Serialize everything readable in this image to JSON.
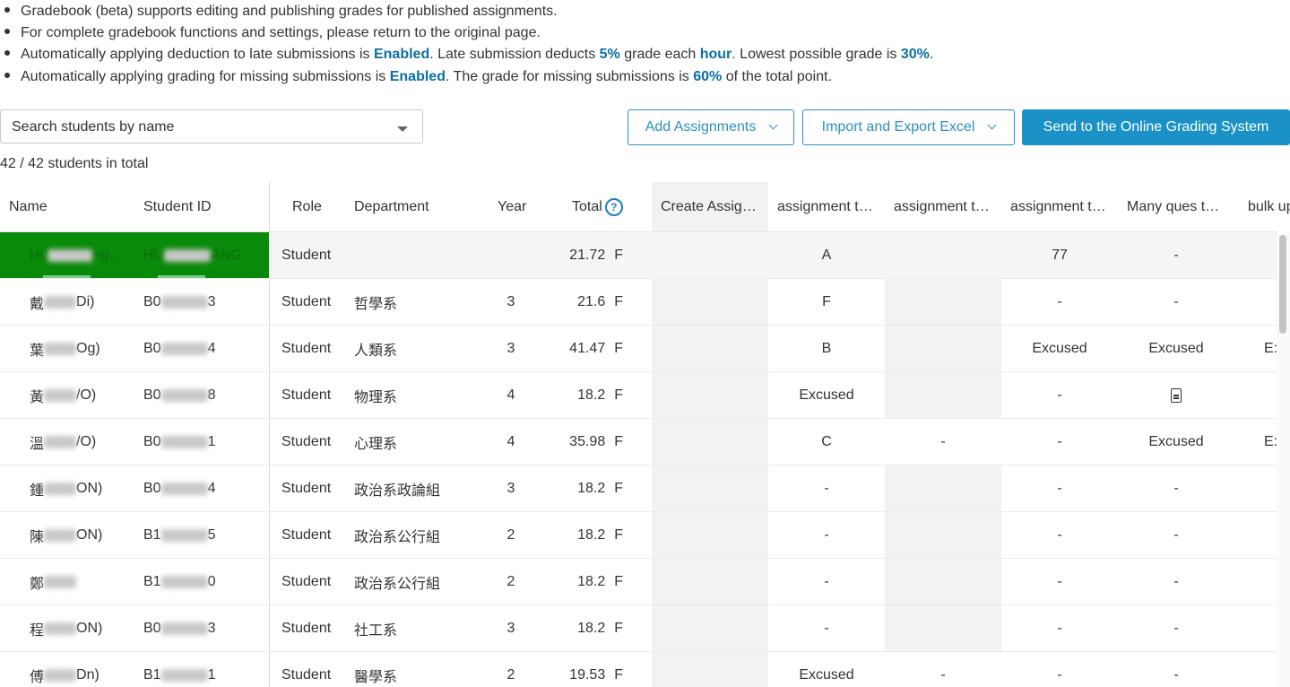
{
  "notes": [
    {
      "parts": [
        {
          "t": "Gradebook (beta) supports editing and publishing grades for published assignments."
        }
      ]
    },
    {
      "parts": [
        {
          "t": "For complete gradebook functions and settings, please return to the original page."
        }
      ]
    },
    {
      "parts": [
        {
          "t": "Automatically applying deduction to late submissions is "
        },
        {
          "t": "Enabled",
          "b": true
        },
        {
          "t": ". Late submission deducts "
        },
        {
          "t": "5%",
          "b": true
        },
        {
          "t": " grade each "
        },
        {
          "t": "hour",
          "b": true
        },
        {
          "t": ". Lowest possible grade is "
        },
        {
          "t": "30%",
          "b": true
        },
        {
          "t": "."
        }
      ]
    },
    {
      "parts": [
        {
          "t": "Automatically applying grading for missing submissions is "
        },
        {
          "t": "Enabled",
          "b": true
        },
        {
          "t": ". The grade for missing submissions is "
        },
        {
          "t": "60%",
          "b": true
        },
        {
          "t": " of the total point."
        }
      ]
    }
  ],
  "search": {
    "placeholder": "Search students by name"
  },
  "toolbar": {
    "add_assignments": "Add Assignments",
    "import_export": "Import and Export Excel",
    "send_grading": "Send to the Online Grading System"
  },
  "count_text": "42 / 42 students in total",
  "headers": {
    "name": "Name",
    "student_id": "Student ID",
    "role": "Role",
    "department": "Department",
    "year": "Year",
    "total": "Total",
    "help": "?",
    "assignments": [
      "Create Assig…",
      "assignment t…",
      "assignment t…",
      "assignment t…",
      "Many ques t…",
      "bulk up"
    ]
  },
  "rows": [
    {
      "name_pre": "Hu",
      "name_post": "ng…",
      "id_pre": "HU",
      "id_post": "ANG",
      "role": "Student",
      "dept": "",
      "year": "",
      "total": "21.72",
      "letter": "F",
      "a": [
        "",
        "A",
        "",
        "77",
        "-",
        ""
      ],
      "highlight": true
    },
    {
      "name_pre": "戴",
      "name_post": "Di)",
      "id_pre": "B0",
      "id_post": "3",
      "role": "Student",
      "dept": "哲學系",
      "year": "3",
      "total": "21.6",
      "letter": "F",
      "a": [
        "",
        "F",
        "",
        "-",
        "-",
        ""
      ]
    },
    {
      "name_pre": "葉",
      "name_post": "Og)",
      "id_pre": "B0",
      "id_post": "4",
      "role": "Student",
      "dept": "人類系",
      "year": "3",
      "total": "41.47",
      "letter": "F",
      "a": [
        "",
        "B",
        "",
        "Excused",
        "Excused",
        "E:"
      ]
    },
    {
      "name_pre": "黃",
      "name_post": "/O)",
      "id_pre": "B0",
      "id_post": "8",
      "role": "Student",
      "dept": "物理系",
      "year": "4",
      "total": "18.2",
      "letter": "F",
      "a": [
        "",
        "Excused",
        "",
        "-",
        "DOC",
        ""
      ]
    },
    {
      "name_pre": "溫",
      "name_post": "/O)",
      "id_pre": "B0",
      "id_post": "1",
      "role": "Student",
      "dept": "心理系",
      "year": "4",
      "total": "35.98",
      "letter": "F",
      "a": [
        "",
        "C",
        "-",
        "-",
        "Excused",
        "E:"
      ]
    },
    {
      "name_pre": "鍾",
      "name_post": "ON)",
      "id_pre": "B0",
      "id_post": "4",
      "role": "Student",
      "dept": "政治系政論組",
      "year": "3",
      "total": "18.2",
      "letter": "F",
      "a": [
        "",
        "-",
        "",
        "-",
        "-",
        ""
      ]
    },
    {
      "name_pre": "陳",
      "name_post": "ON)",
      "id_pre": "B1",
      "id_post": "5",
      "role": "Student",
      "dept": "政治系公行組",
      "year": "2",
      "total": "18.2",
      "letter": "F",
      "a": [
        "",
        "-",
        "",
        "-",
        "-",
        ""
      ]
    },
    {
      "name_pre": "鄭",
      "name_post": "",
      "id_pre": "B1",
      "id_post": "0",
      "role": "Student",
      "dept": "政治系公行組",
      "year": "2",
      "total": "18.2",
      "letter": "F",
      "a": [
        "",
        "-",
        "",
        "-",
        "-",
        ""
      ]
    },
    {
      "name_pre": "程",
      "name_post": "ON)",
      "id_pre": "B0",
      "id_post": "3",
      "role": "Student",
      "dept": "社工系",
      "year": "3",
      "total": "18.2",
      "letter": "F",
      "a": [
        "",
        "-",
        "",
        "-",
        "-",
        ""
      ]
    },
    {
      "name_pre": "傅",
      "name_post": "Dn)",
      "id_pre": "B1",
      "id_post": "1",
      "role": "Student",
      "dept": "醫學系",
      "year": "2",
      "total": "19.53",
      "letter": "F",
      "a": [
        "",
        "Excused",
        "-",
        "-",
        "-",
        ""
      ]
    }
  ],
  "colors": {
    "accent": "#1a91c7",
    "highlight": "#0a8a0a",
    "bold_text": "#0b6fa4"
  }
}
